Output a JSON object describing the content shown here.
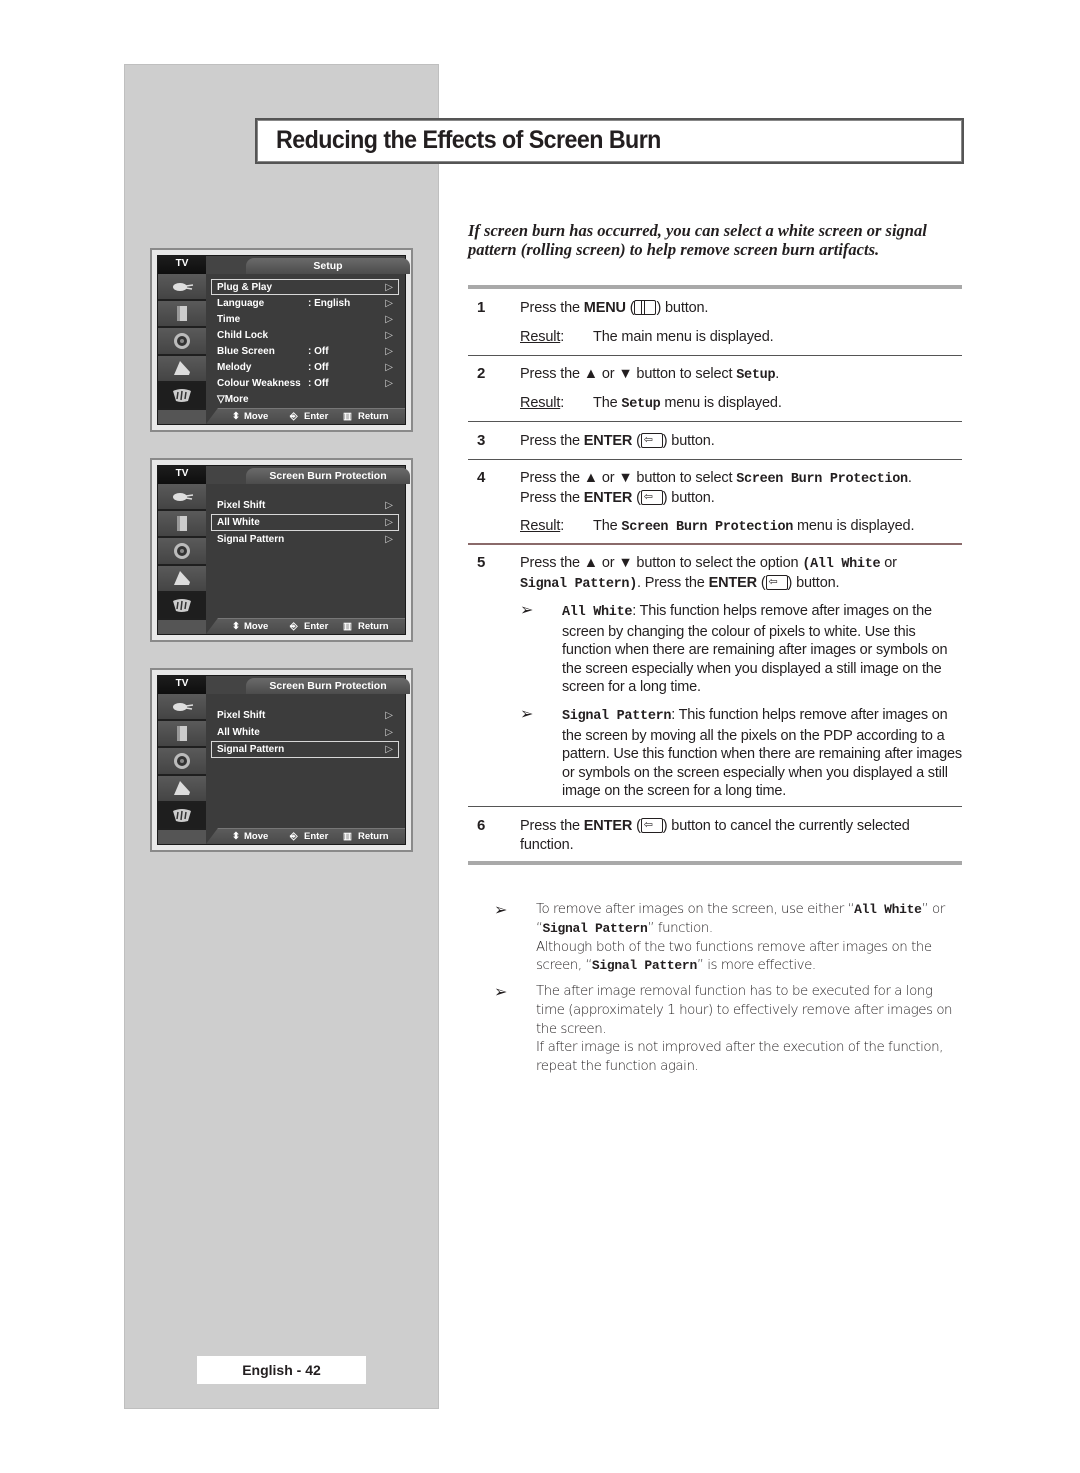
{
  "page": {
    "title": "Reducing the Effects of Screen Burn",
    "intro": "If screen burn has occurred, you can select a white screen or signal pattern (rolling screen) to help remove screen burn artifacts.",
    "footer": "English - 42"
  },
  "osd_common": {
    "tv_tab": "TV",
    "footer_move": "Move",
    "footer_enter": "Enter",
    "footer_return": "Return",
    "sidebar_icons": [
      "plug-icon",
      "antenna-icon",
      "speaker-icon",
      "picture-icon",
      "setup-icon"
    ],
    "arrow": "▷"
  },
  "osd_setup": {
    "menu_title": "Setup",
    "items": [
      {
        "label": "Plug & Play",
        "value": "",
        "highlighted": true
      },
      {
        "label": "Language",
        "value": ": English",
        "highlighted": false
      },
      {
        "label": "Time",
        "value": "",
        "highlighted": false
      },
      {
        "label": "Child Lock",
        "value": "",
        "highlighted": false
      },
      {
        "label": "Blue Screen",
        "value": ": Off",
        "highlighted": false
      },
      {
        "label": "Melody",
        "value": ": Off",
        "highlighted": false
      },
      {
        "label": "Colour Weakness",
        "value": ": Off",
        "highlighted": false
      }
    ],
    "more": "▽More"
  },
  "osd_sbp_1": {
    "menu_title": "Screen Burn Protection",
    "items": [
      {
        "label": "Pixel Shift",
        "highlighted": false
      },
      {
        "label": "All White",
        "highlighted": true
      },
      {
        "label": "Signal Pattern",
        "highlighted": false
      }
    ]
  },
  "osd_sbp_2": {
    "menu_title": "Screen Burn Protection",
    "items": [
      {
        "label": "Pixel Shift",
        "highlighted": false
      },
      {
        "label": "All White",
        "highlighted": false
      },
      {
        "label": "Signal Pattern",
        "highlighted": true
      }
    ]
  },
  "steps": {
    "s1": {
      "num": "1",
      "pre": "Press the ",
      "key": "MENU",
      "post": ") button.",
      "result_label": "Result",
      "result": "The main menu is displayed."
    },
    "s2": {
      "num": "2",
      "pre": "Press the ▲ or ▼ button to select ",
      "code": "Setup",
      "post": ".",
      "result_label": "Result",
      "result_pre": "The ",
      "result_code": "Setup",
      "result_post": " menu is displayed."
    },
    "s3": {
      "num": "3",
      "pre": "Press the ",
      "key": "ENTER",
      "post": ") button."
    },
    "s4": {
      "num": "4",
      "pre": "Press the ▲ or ▼ button to select ",
      "code": "Screen Burn Protection",
      "post": ".",
      "line2_pre": "Press the ",
      "line2_key": "ENTER",
      "line2_post": ") button.",
      "result_label": "Result",
      "result_pre": "The ",
      "result_code": "Screen Burn Protection",
      "result_post": " menu is displayed."
    },
    "s5": {
      "num": "5",
      "pre": "Press the ▲ or ▼ button to select the option ",
      "code1": "(All White",
      "mid": " or",
      "code2": "Signal Pattern)",
      "post_pre": ". Press the ",
      "key": "ENTER",
      "post": ") button.",
      "sub1_code": "All White",
      "sub1_text": ": This function helps remove after images on the screen by changing the colour of pixels to white. Use this function when there are remaining after images or symbols on the screen especially when you displayed a still image on the screen for a long time.",
      "sub2_code": "Signal Pattern",
      "sub2_text": ": This function helps remove after images on the screen by moving all the pixels on the PDP according to a pattern. Use this function when there are remaining after images or symbols on the screen especially when you displayed a still image on the screen for a long time."
    },
    "s6": {
      "num": "6",
      "pre": "Press the ",
      "key": "ENTER",
      "post": ") button to cancel the currently selected function."
    }
  },
  "notes": {
    "n1_pre": "To remove after images on the screen, use either “",
    "n1_code1": "All White",
    "n1_mid": "” or “",
    "n1_code2": "Signal Pattern",
    "n1_post": "” function.",
    "n1_line2_pre": "Although both of the two functions remove after images on the screen, “",
    "n1_line2_code": "Signal Pattern",
    "n1_line2_post": "” is more effective.",
    "n2": "The after image removal function has to be executed for a long time (approximately 1 hour) to effectively remove after images on the screen.",
    "n2_line2": "If after image is not improved after the execution of the function, repeat the function again."
  },
  "glyphs": {
    "arrow_bullet": "➢"
  }
}
